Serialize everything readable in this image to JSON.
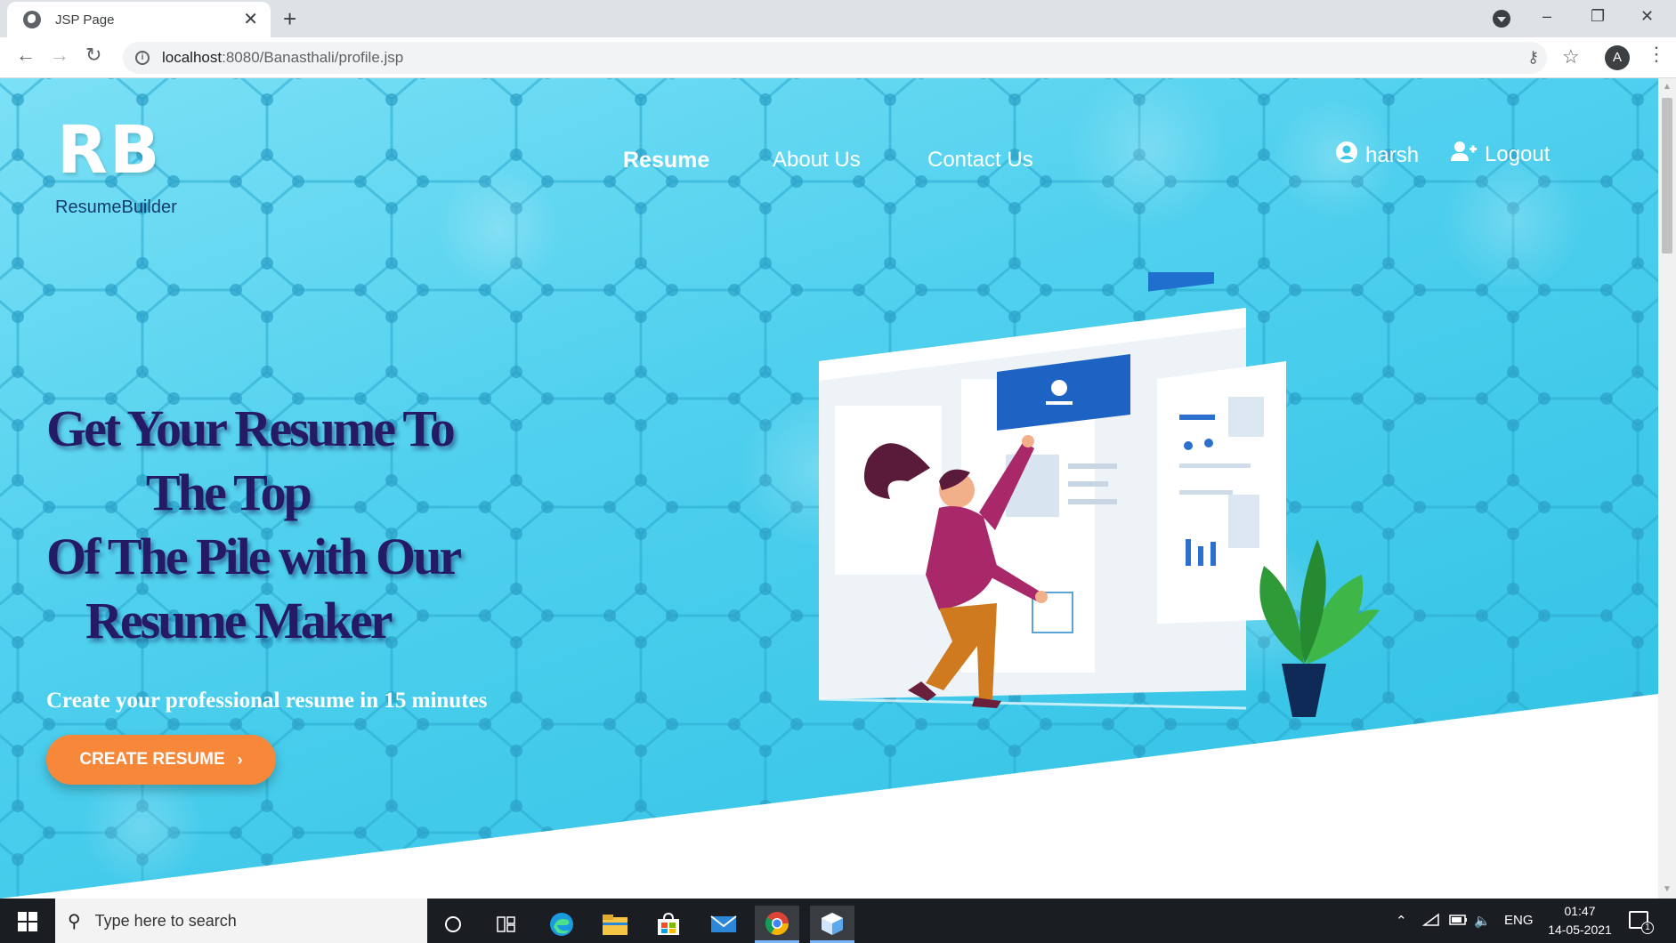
{
  "browser": {
    "tab_title": "JSP Page",
    "tab_close": "✕",
    "new_tab": "+",
    "url_host": "localhost",
    "url_rest": ":8080/Banasthali/profile.jsp",
    "profile_initial": "A",
    "window_controls": {
      "minimize": "–",
      "restore": "❐",
      "close": "✕"
    }
  },
  "site": {
    "logo_text": "RB",
    "brand_name": "ResumeBuilder",
    "nav": [
      {
        "label": "Resume",
        "active": true
      },
      {
        "label": "About Us",
        "active": false
      },
      {
        "label": "Contact Us",
        "active": false
      }
    ],
    "user_name": "harsh",
    "logout_label": "Logout"
  },
  "hero": {
    "headline_lines": [
      "Get Your Resume To",
      "The Top",
      "Of The Pile with Our",
      "Resume Maker"
    ],
    "subline": "Create your professional resume in 15 minutes",
    "cta_label": "CREATE RESUME",
    "cta_chevron": "›"
  },
  "taskbar": {
    "search_placeholder": "Type here to search",
    "language": "ENG",
    "time": "01:47",
    "date": "14-05-2021",
    "notification_count": "1"
  },
  "colors": {
    "hero_top": "#7be0f5",
    "hero_bottom": "#2dc0e4",
    "headline": "#241a66",
    "cta": "#f7883a",
    "brand_name": "#123c6e"
  },
  "icons": [
    "globe-icon",
    "back-icon",
    "forward-icon",
    "reload-icon",
    "info-icon",
    "key-icon",
    "star-icon",
    "kebab-menu-icon",
    "user-circle-icon",
    "user-plus-icon",
    "windows-start-icon",
    "search-icon",
    "cortana-icon",
    "task-view-icon",
    "edge-icon",
    "file-explorer-icon",
    "store-icon",
    "mail-icon",
    "chrome-icon",
    "app-cube-icon",
    "chevron-up-icon",
    "wifi-icon",
    "battery-icon",
    "speaker-icon",
    "notification-icon"
  ]
}
